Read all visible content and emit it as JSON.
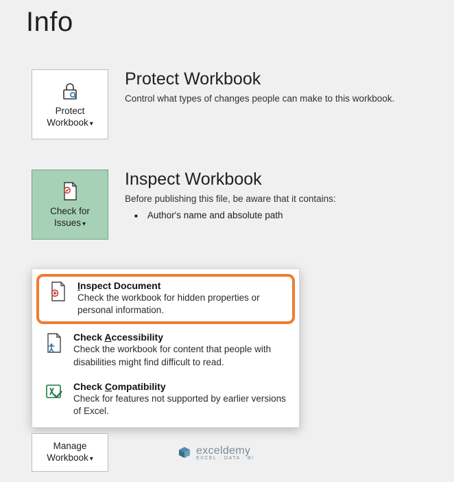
{
  "page": {
    "title": "Info"
  },
  "protect": {
    "button_label_line1": "Protect",
    "button_label_line2": "Workbook",
    "heading": "Protect Workbook",
    "desc": "Control what types of changes people can make to this workbook."
  },
  "inspect": {
    "button_label_line1": "Check for",
    "button_label_line2": "Issues",
    "heading": "Inspect Workbook",
    "desc": "Before publishing this file, be aware that it contains:",
    "bullet1": "Author's name and absolute path"
  },
  "menu": {
    "inspect_doc": {
      "title_pre": "I",
      "title_post": "nspect Document",
      "desc": "Check the workbook for hidden properties or personal information."
    },
    "accessibility": {
      "title_pre": "Check ",
      "title_u": "A",
      "title_post": "ccessibility",
      "desc": "Check the workbook for content that people with disabilities might find difficult to read."
    },
    "compat": {
      "title_pre": "Check ",
      "title_u": "C",
      "title_post": "ompatibility",
      "desc": "Check for features not supported by earlier versions of Excel."
    }
  },
  "manage": {
    "button_label_line1": "Manage",
    "button_label_line2": "Workbook"
  },
  "watermark": {
    "name": "exceldemy",
    "sub": "EXCEL · DATA · BI"
  }
}
